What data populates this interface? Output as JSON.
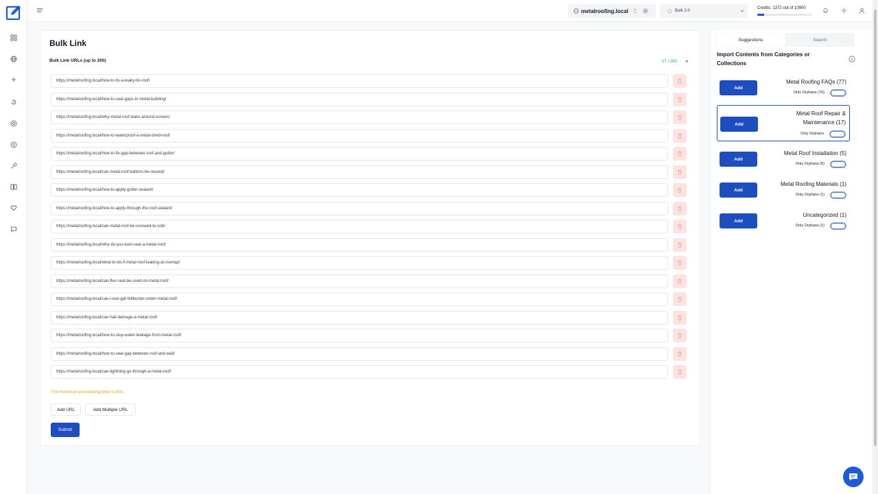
{
  "colors": {
    "primary": "#1e4dbf",
    "danger_soft": "#fde2e2",
    "success": "#16a34a",
    "warning": "#f59e0b"
  },
  "sidebar": {
    "logo": "edit-square-logo",
    "icons": [
      "dashboard-icon",
      "globe-icon",
      "plus-icon",
      "history-icon",
      "target-icon",
      "dollar-icon",
      "key-icon",
      "book-icon",
      "heart-icon",
      "chat-icon"
    ]
  },
  "topbar": {
    "site": "metalroofing.local",
    "bulk": "Bulk 2.0",
    "credits_text": "Credits: 1372 out of 10900",
    "credits_used_fraction": 0.126
  },
  "main": {
    "title": "Bulk Link",
    "urls_label": "Bulk Link URLs (up to 200)",
    "counter": "17 / 200",
    "clear": "×",
    "urls": [
      "https://metalroofing.local/how-to-fix-a-leaky-tin-roof/",
      "https://metalroofing.local/how-to-seal-gaps-in-metal-building/",
      "https://metalroofing.local/why-metal-roof-leaks-around-screws/",
      "https://metalroofing.local/how-to-waterproof-a-metal-shed-roof/",
      "https://metalroofing.local/how-to-fix-gap-between-roof-and-gutter/",
      "https://metalroofing.local/can-metal-roof-battens-be-reused/",
      "https://metalroofing.local/how-to-apply-gutter-sealant/",
      "https://metalroofing.local/how-to-apply-through-the-roof-sealant/",
      "https://metalroofing.local/can-metal-roof-be-screwed-to-osb/",
      "https://metalroofing.local/why-do-you-kool-seal-a-metal-roof/",
      "https://metalroofing.local/what-to-do-if-metal-roof-leaking-at-overlap/",
      "https://metalroofing.local/can-flex-seal-be-used-on-metal-roof/",
      "https://metalroofing.local/can-i-use-gaf-feltbuster-under-metal-roof/",
      "https://metalroofing.local/can-hail-damage-a-metal-roof/",
      "https://metalroofing.local/how-to-stop-water-leakage-from-metal-roof/",
      "https://metalroofing.local/how-to-seal-gap-between-roof-and-wall/",
      "https://metalroofing.local/can-lightning-go-through-a-metal-roof/"
    ],
    "notice": "The minimum processing time is 60s",
    "add_url": "Add URL",
    "add_multiple": "Add Multiple URL",
    "submit": "Submit"
  },
  "panel": {
    "tabs": [
      "Suggestions",
      "Search"
    ],
    "active_tab": "Suggestions",
    "import_title": "Import Contents from Categories or Collections",
    "add_label": "Add",
    "categories": [
      {
        "name": "Metal Roofing FAQs (77)",
        "orphans": "Only Orphans (76)",
        "selected": false
      },
      {
        "name": "Metal Roof Repair & Maintenance (17)",
        "orphans": "Only Orphans",
        "selected": true
      },
      {
        "name": "Metal Roof Installation (5)",
        "orphans": "Only Orphans (5)",
        "selected": false
      },
      {
        "name": "Metal Roofing Materials (1)",
        "orphans": "Only Orphans (1)",
        "selected": false
      },
      {
        "name": "Uncategorized (1)",
        "orphans": "Only Orphans (1)",
        "selected": false
      }
    ]
  }
}
